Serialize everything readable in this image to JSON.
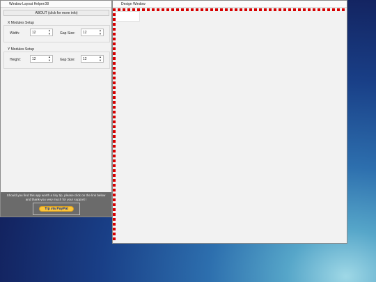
{
  "helper_window": {
    "title": "Window Layout Helper.08",
    "about_button": "ABOUT (click for more info)",
    "x_group": {
      "title": "X Modules Setup",
      "size_label": "Width:",
      "size_value": "12",
      "gap_label": "Gap Size:",
      "gap_value": "12"
    },
    "y_group": {
      "title": "Y Modules Setup",
      "size_label": "Height:",
      "size_value": "12",
      "gap_label": "Gap Size:",
      "gap_value": "12"
    },
    "footer": {
      "message_line1": "Should you find this app worth a tiny tip, please click on the link below",
      "message_line2": "and thank-you very much for your support !",
      "tip_button": "Tip via PayPal"
    }
  },
  "design_window": {
    "title": "Design Window"
  },
  "colors": {
    "guide_dashes": "#d60000",
    "tip_button": "#fcc439",
    "footer_bg": "#6b6b6b"
  },
  "icons": {
    "spinner_up": "▲",
    "spinner_down": "▼"
  }
}
